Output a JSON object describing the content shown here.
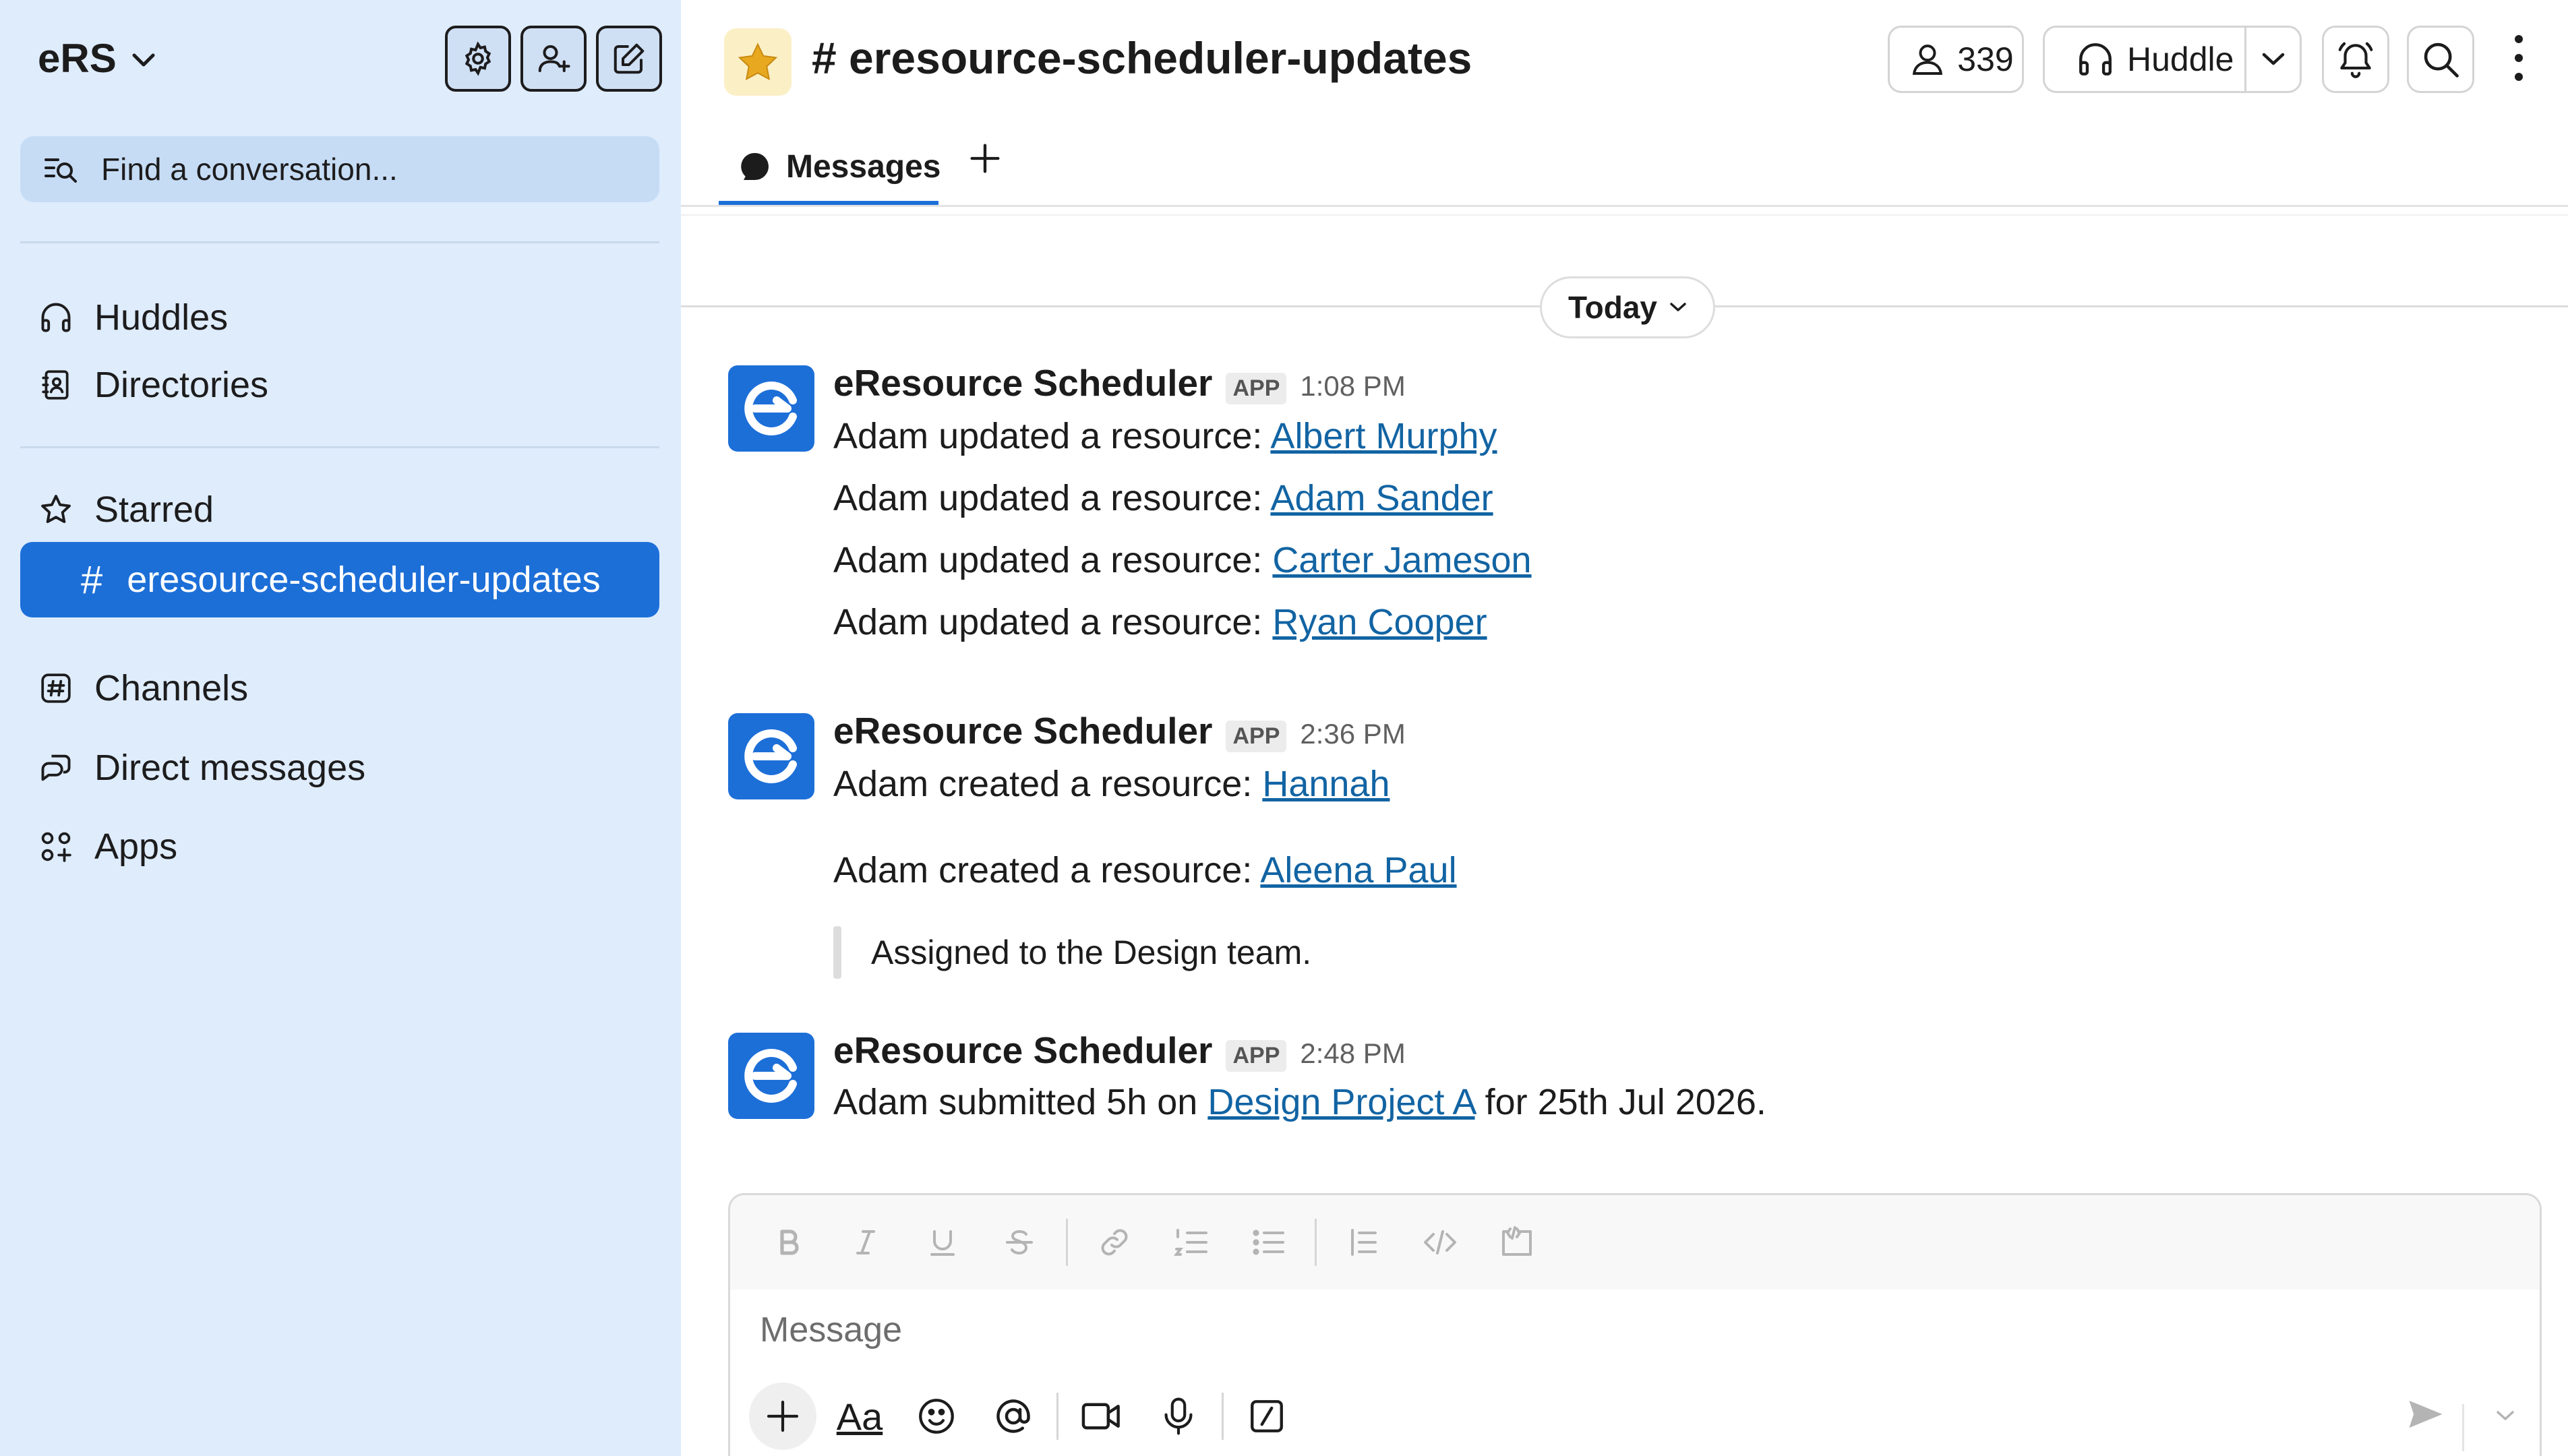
{
  "workspace": {
    "name": "eRS"
  },
  "sidebar": {
    "search_placeholder": "Find a conversation...",
    "items_top": [
      {
        "label": "Huddles",
        "icon": "headphones-icon"
      },
      {
        "label": "Directories",
        "icon": "directory-icon"
      }
    ],
    "starred_label": "Starred",
    "active_channel": "eresource-scheduler-updates",
    "items_bottom": [
      {
        "label": "Channels",
        "icon": "channels-icon"
      },
      {
        "label": "Direct messages",
        "icon": "direct-messages-icon"
      },
      {
        "label": "Apps",
        "icon": "apps-icon"
      }
    ]
  },
  "header": {
    "channel_name": "# eresource-scheduler-updates",
    "member_count": "339",
    "huddle_label": "Huddle"
  },
  "tabs": {
    "messages_label": "Messages"
  },
  "day_divider": {
    "label": "Today"
  },
  "messages": [
    {
      "sender": "eResource Scheduler",
      "badge": "APP",
      "time": "1:08 PM",
      "lines": [
        {
          "text": "Adam updated a resource: ",
          "link": "Albert Murphy"
        },
        {
          "text": "Adam updated a resource: ",
          "link": "Adam Sander"
        },
        {
          "text": "Adam updated a resource: ",
          "link": "Carter Jameson"
        },
        {
          "text": "Adam updated a resource: ",
          "link": "Ryan Cooper"
        }
      ]
    },
    {
      "sender": "eResource Scheduler",
      "badge": "APP",
      "time": "2:36 PM",
      "lines": [
        {
          "text": "Adam created a resource: ",
          "link": "Hannah"
        },
        {
          "text": "Adam created a resource: ",
          "link": "Aleena Paul"
        }
      ],
      "quote": "Assigned to the Design team."
    },
    {
      "sender": "eResource Scheduler",
      "badge": "APP",
      "time": "2:48 PM",
      "lines": [
        {
          "text": "Adam submitted 5h on ",
          "link": "Design Project A",
          "after": " for 25th Jul 2026."
        }
      ]
    }
  ],
  "composer": {
    "placeholder": "Message",
    "aa_label": "Aa"
  },
  "colors": {
    "sidebar_bg": "#deecfc",
    "accent": "#1d6fd8",
    "link": "#1264a3",
    "star": "#e8a820"
  }
}
